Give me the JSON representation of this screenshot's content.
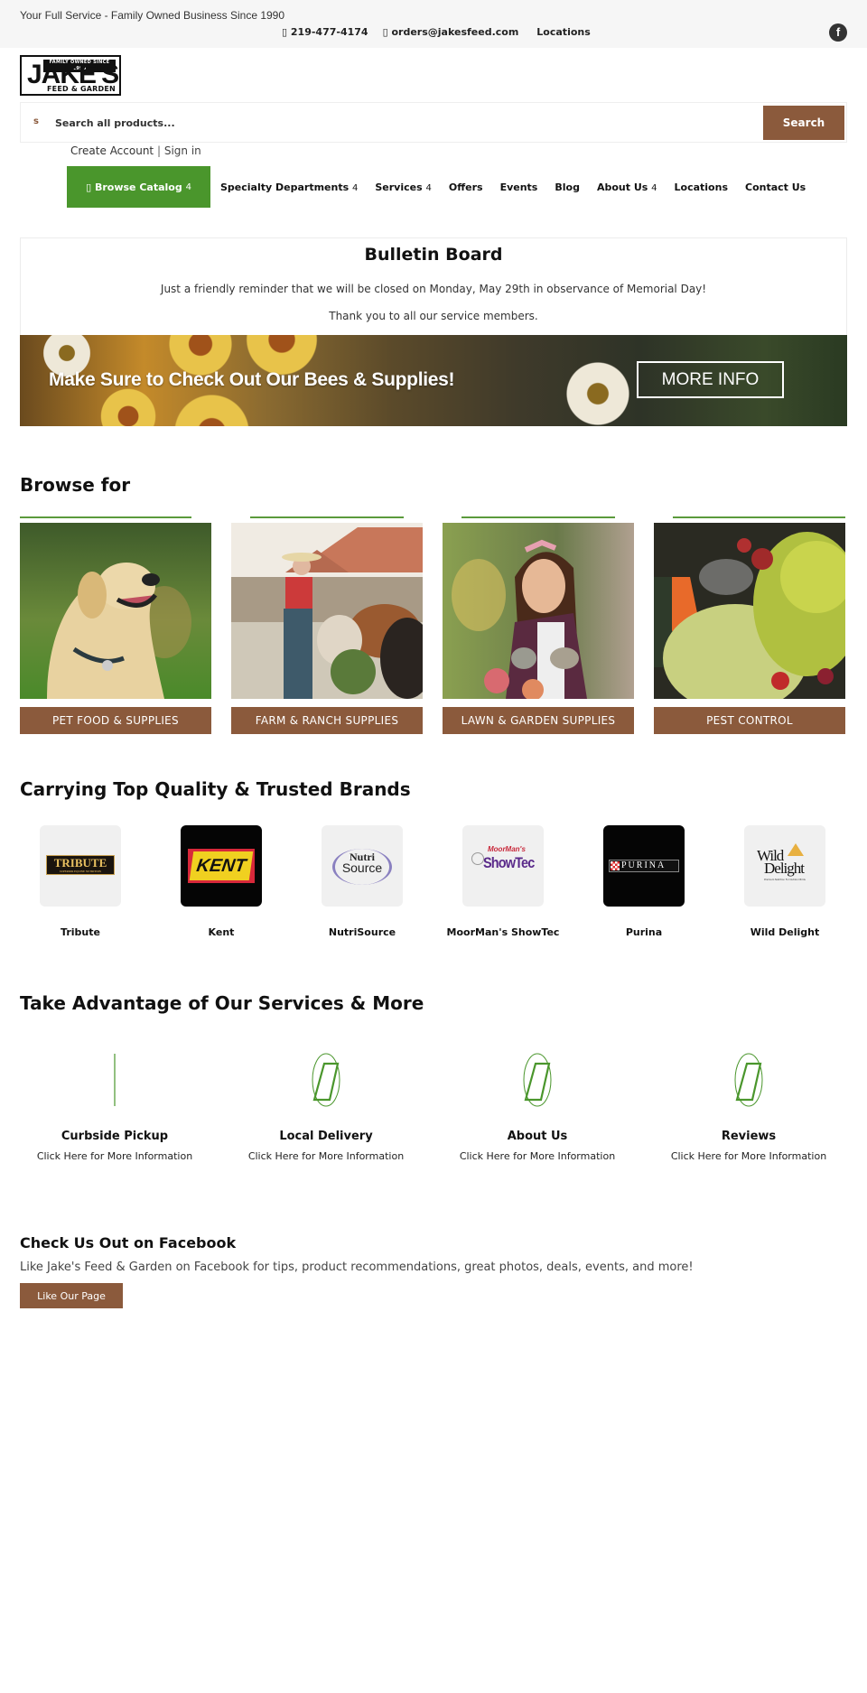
{
  "topbar": {
    "tagline": "Your Full Service - Family Owned Business Since 1990",
    "phone_icon": "phone-icon",
    "phone": "219-477-4174",
    "email_icon": "envelope-icon",
    "email": "orders@jakesfeed.com",
    "locations": "Locations",
    "social_icon": "facebook-icon",
    "social_glyph": "f"
  },
  "logo": {
    "tagline": "FAMILY OWNED SINCE 1990",
    "name": "JAKE'S",
    "subname": "FEED & GARDEN"
  },
  "search": {
    "icon": "s",
    "placeholder": "Search all products...",
    "value": "",
    "button": "Search"
  },
  "account": {
    "create": "Create Account",
    "separator": "|",
    "signin": "Sign in"
  },
  "nav": {
    "browse_icon": "▯",
    "browse": "Browse Catalog",
    "caret": "4",
    "items": [
      {
        "label": "Specialty Departments",
        "dropdown": true
      },
      {
        "label": "Services",
        "dropdown": true
      },
      {
        "label": "Offers",
        "dropdown": false
      },
      {
        "label": "Events",
        "dropdown": false
      },
      {
        "label": "Blog",
        "dropdown": false
      },
      {
        "label": "About Us",
        "dropdown": true
      },
      {
        "label": "Locations",
        "dropdown": false
      },
      {
        "label": "Contact Us",
        "dropdown": false
      }
    ]
  },
  "bulletin": {
    "title": "Bulletin Board",
    "line1": "Just a friendly reminder that we will be closed on Monday, May 29th in observance of Memorial Day!",
    "line2": "Thank you to all our service members."
  },
  "banner": {
    "headline": "Make Sure to Check Out Our Bees & Supplies!",
    "button": "MORE INFO"
  },
  "browse": {
    "title": "Browse for",
    "categories": [
      {
        "label": "PET FOOD & SUPPLIES",
        "image": "golden-retriever-photo"
      },
      {
        "label": "FARM & RANCH SUPPLIES",
        "image": "farmer-feeding-cattle-photo"
      },
      {
        "label": "LAWN & GARDEN SUPPLIES",
        "image": "woman-gardening-photo"
      },
      {
        "label": "PEST CONTROL",
        "image": "spraying-plants-photo"
      }
    ]
  },
  "brands": {
    "title": "Carrying Top Quality & Trusted Brands",
    "items": [
      {
        "name": "Tribute",
        "logo_text": "TRIBUTE",
        "logo_sub": "SUPERIOR EQUINE NUTRITION"
      },
      {
        "name": "Kent",
        "logo_text": "KENT"
      },
      {
        "name": "NutriSource",
        "logo_text": "Nutri",
        "logo_text2": "Source"
      },
      {
        "name": "MoorMan's ShowTec",
        "logo_text": "MoorMan's",
        "logo_text2": "ShowTec"
      },
      {
        "name": "Purina",
        "logo_text": "PURINA"
      },
      {
        "name": "Wild Delight",
        "logo_text": "Wild",
        "logo_text2": "Delight",
        "logo_sub": "Premium Nutrition For Outdoor Birds"
      }
    ]
  },
  "services": {
    "title": "Take Advantage of Our Services & More",
    "items": [
      {
        "title": "Curbside Pickup",
        "link": "Click Here for More Information",
        "icon": "curbside-pickup-icon"
      },
      {
        "title": "Local Delivery",
        "link": "Click Here for More Information",
        "icon": "local-delivery-icon"
      },
      {
        "title": "About Us",
        "link": "Click Here for More Information",
        "icon": "about-us-icon"
      },
      {
        "title": "Reviews",
        "link": "Click Here for More Information",
        "icon": "reviews-icon"
      }
    ]
  },
  "facebook": {
    "title": "Check Us Out on Facebook",
    "text": "Like Jake's Feed & Garden on Facebook for tips, product recommendations, great photos, deals, events, and more!",
    "button": "Like Our Page"
  },
  "colors": {
    "brand_brown": "#8b5a3c",
    "brand_green": "#4a962c",
    "topbar_bg": "#f6f6f6"
  }
}
